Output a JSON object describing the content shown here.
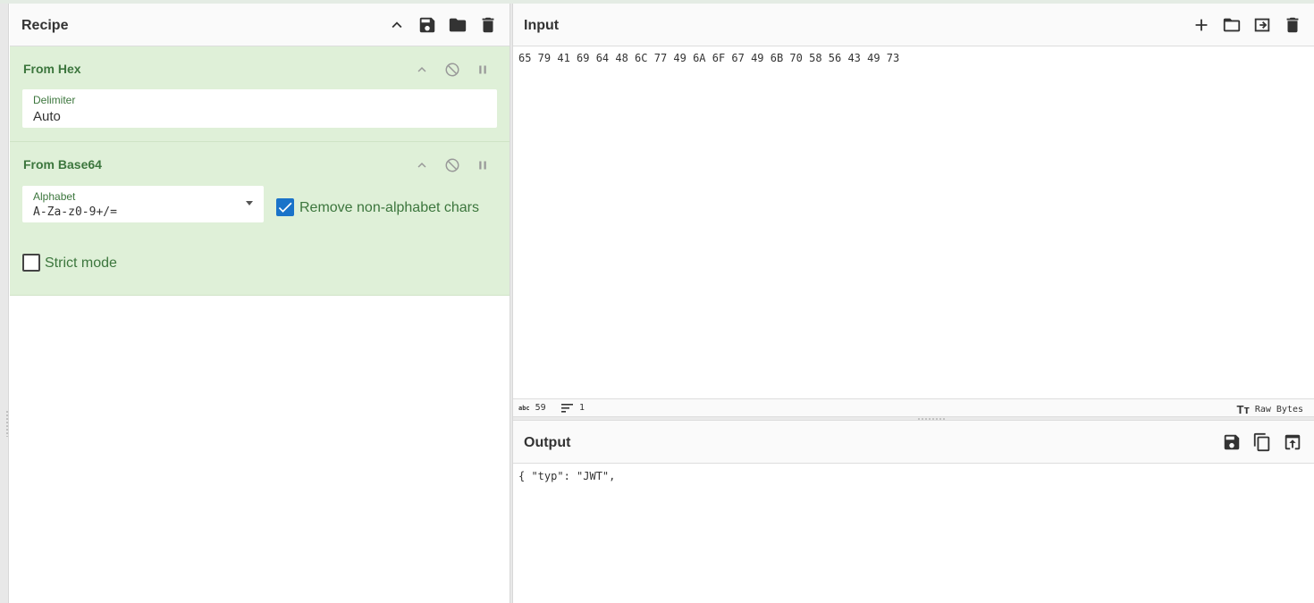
{
  "recipe": {
    "title": "Recipe",
    "header_icons": [
      "chevron-up-icon",
      "save-icon",
      "folder-icon",
      "trash-icon"
    ],
    "operations": [
      {
        "name": "From Hex",
        "delimiter_label": "Delimiter",
        "delimiter_value": "Auto"
      },
      {
        "name": "From Base64",
        "alphabet_label": "Alphabet",
        "alphabet_value": "A-Za-z0-9+/=",
        "remove_label": "Remove non-alphabet chars",
        "remove_checked": true,
        "strict_label": "Strict mode",
        "strict_checked": false
      }
    ]
  },
  "input": {
    "title": "Input",
    "text": "65 79 41 69 64 48 6C 77 49 6A 6F 67 49 6B 70 58 56 43 49 73",
    "status": {
      "length_icon": "abc",
      "length": "59",
      "lines": "1",
      "encoding": "Raw Bytes"
    }
  },
  "output": {
    "title": "Output",
    "text": "{ \"typ\": \"JWT\","
  },
  "colors": {
    "op_bg": "#dff0d8",
    "op_text": "#3c763d",
    "accent": "#1a73c9"
  }
}
